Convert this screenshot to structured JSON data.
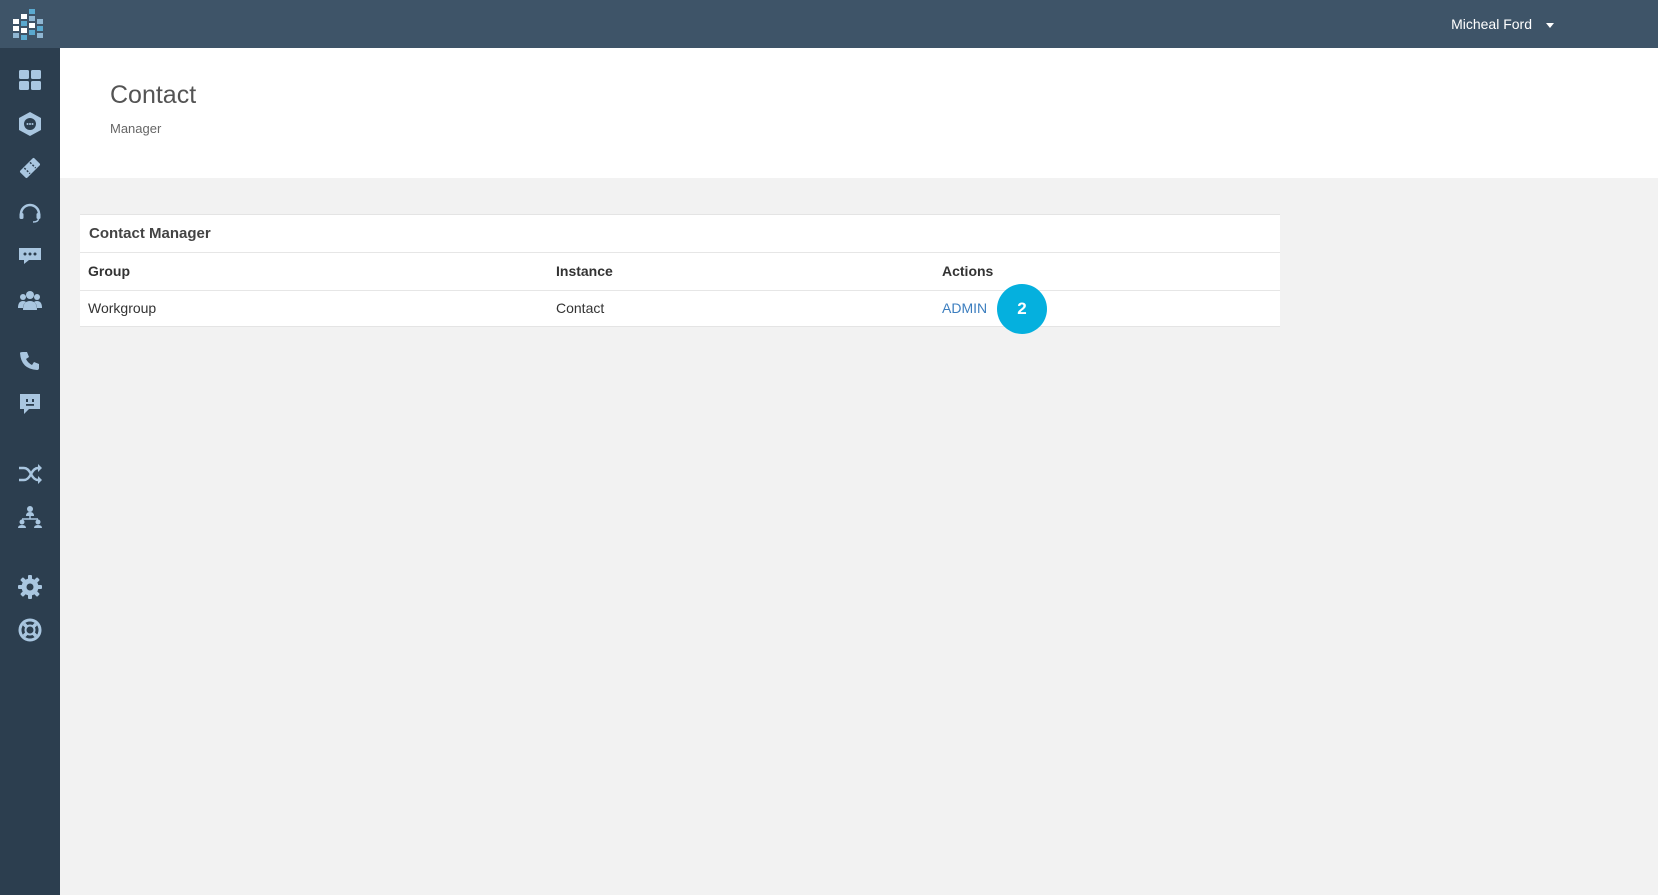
{
  "header": {
    "user_name": "Micheal Ford"
  },
  "sidebar": {
    "items": [
      {
        "icon": "dashboard-icon"
      },
      {
        "icon": "hexagon-chat-icon"
      },
      {
        "icon": "ticket-icon"
      },
      {
        "icon": "headset-icon"
      },
      {
        "icon": "chat-bubble-icon"
      },
      {
        "icon": "users-icon"
      },
      {
        "icon": "phone-icon"
      },
      {
        "icon": "message-icon"
      },
      {
        "icon": "shuffle-icon"
      },
      {
        "icon": "org-chart-icon"
      },
      {
        "icon": "gear-icon"
      },
      {
        "icon": "lifebuoy-icon"
      }
    ]
  },
  "page": {
    "title": "Contact",
    "subtitle": "Manager"
  },
  "panel": {
    "title": "Contact Manager",
    "columns": [
      "Group",
      "Instance",
      "Actions"
    ],
    "rows": [
      {
        "group": "Workgroup",
        "instance": "Contact",
        "action": "ADMIN"
      }
    ]
  },
  "step_badge": "2",
  "colors": {
    "topbar": "#3e5468",
    "sidebar": "#2c3e4f",
    "link": "#3c7ebf",
    "badge": "#05b0de"
  }
}
